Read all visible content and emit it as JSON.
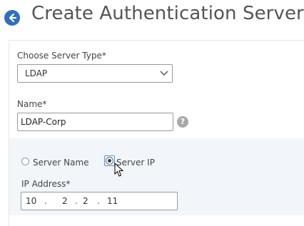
{
  "header": {
    "back_icon": "arrow-left-circle-icon",
    "title": "Create Authentication Server"
  },
  "form": {
    "server_type": {
      "label": "Choose Server Type*",
      "value": "LDAP",
      "icon": "chevron-down-icon"
    },
    "name": {
      "label": "Name*",
      "value": "LDAP-Corp",
      "help_icon": "question-circle-icon",
      "help_text": "?"
    },
    "address_mode": {
      "options": [
        {
          "label": "Server Name",
          "selected": false
        },
        {
          "label": "Server IP",
          "selected": true
        }
      ]
    },
    "ip_address": {
      "label": "IP Address*",
      "octets": [
        "10",
        "2",
        "2",
        "11"
      ],
      "separator": "."
    }
  },
  "colors": {
    "accent": "#2f6fbd",
    "sub_panel_bg": "#f2f6fa",
    "focus": "#5a8fd8"
  },
  "cursor": {
    "icon": "mouse-pointer-icon"
  }
}
